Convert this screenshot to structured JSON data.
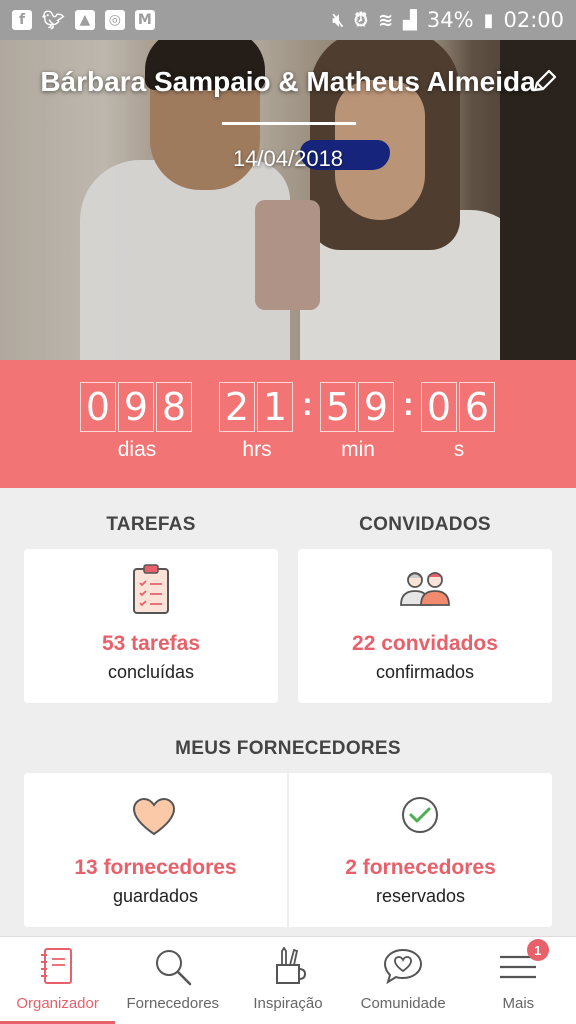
{
  "status_bar": {
    "left_icons": [
      "facebook-icon",
      "twitter-icon",
      "gallery-icon",
      "instagram-icon",
      "gmail-icon"
    ],
    "battery": "34%",
    "time": "02:00"
  },
  "hero": {
    "couple_names": "Bárbara Sampaio & Matheus Almeida",
    "wedding_date": "14/04/2018"
  },
  "countdown": {
    "days": [
      "0",
      "9",
      "8"
    ],
    "hours": [
      "2",
      "1"
    ],
    "minutes": [
      "5",
      "9"
    ],
    "seconds": [
      "0",
      "6"
    ],
    "labels": {
      "days": "dias",
      "hours": "hrs",
      "minutes": "min",
      "seconds": "s"
    }
  },
  "tasks": {
    "title": "TAREFAS",
    "count": "53 tarefas",
    "sub": "concluídas"
  },
  "guests": {
    "title": "CONVIDADOS",
    "count": "22 convidados",
    "sub": "confirmados"
  },
  "vendors": {
    "title": "MEUS FORNECEDORES",
    "saved": {
      "count": "13 fornecedores",
      "sub": "guardados"
    },
    "booked": {
      "count": "2 fornecedores",
      "sub": "reservados"
    }
  },
  "nav": {
    "items": [
      {
        "label": "Organizador",
        "icon": "notebook-icon",
        "active": true
      },
      {
        "label": "Fornecedores",
        "icon": "search-icon"
      },
      {
        "label": "Inspiração",
        "icon": "pencil-cup-icon"
      },
      {
        "label": "Comunidade",
        "icon": "chat-heart-icon"
      },
      {
        "label": "Mais",
        "icon": "menu-icon",
        "badge": "1"
      }
    ]
  },
  "colors": {
    "accent": "#e8616a",
    "countdown_bg": "#f37474",
    "status_bar": "#9e9e9e"
  }
}
